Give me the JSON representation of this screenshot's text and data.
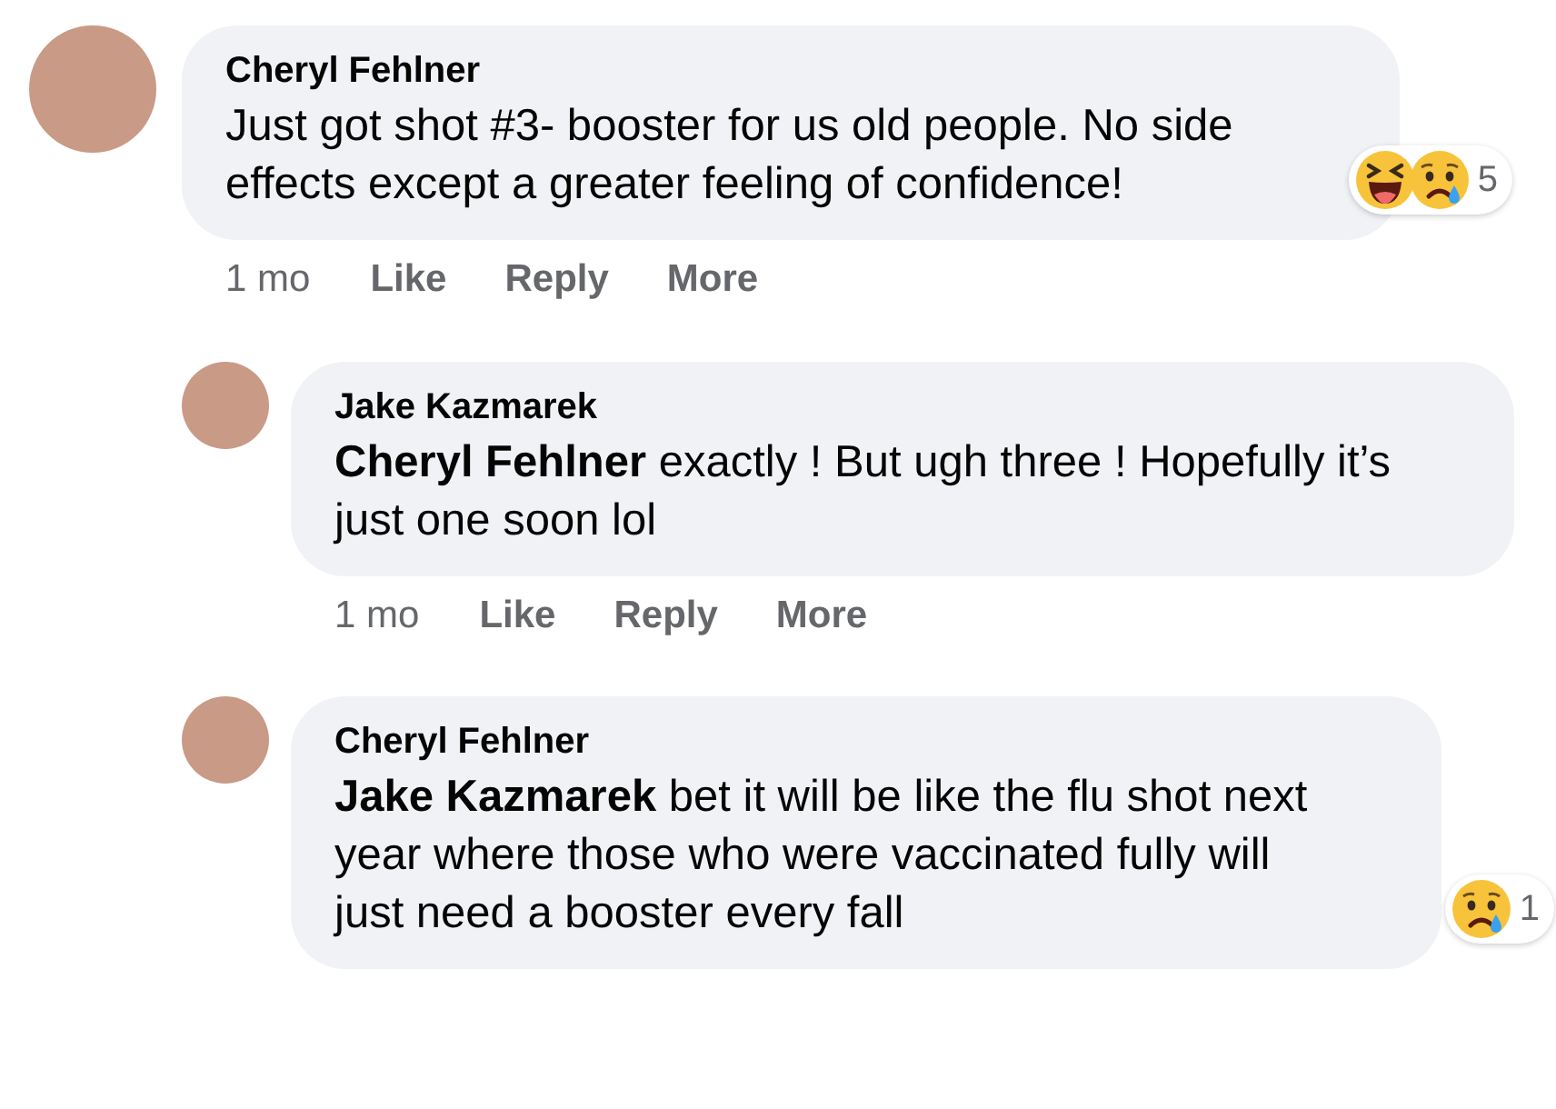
{
  "comments": [
    {
      "kind": "comment",
      "author": "Cheryl Fehlner",
      "text": "Just got shot #3- booster for us old people. No side effects except a greater feeling of confidence!",
      "reactions": {
        "emojis": [
          {
            "kind": "haha"
          },
          {
            "kind": "sad"
          }
        ],
        "count": "5"
      },
      "actions": {
        "time": "1 mo",
        "like": "Like",
        "reply": "Reply",
        "more": "More"
      }
    },
    {
      "kind": "reply",
      "author": "Jake Kazmarek",
      "text": "**Cheryl Fehlner** exactly ! But ugh three ! Hopefully it’s just one soon lol",
      "actions": {
        "time": "1 mo",
        "like": "Like",
        "reply": "Reply",
        "more": "More"
      }
    },
    {
      "kind": "reply",
      "author": "Cheryl Fehlner",
      "text": "**Jake Kazmarek** bet it will be like the flu shot next year where those who were vaccinated fully will just need a booster every fall",
      "reactions": {
        "emojis": [
          {
            "kind": "sad"
          }
        ],
        "count": "1"
      }
    }
  ]
}
